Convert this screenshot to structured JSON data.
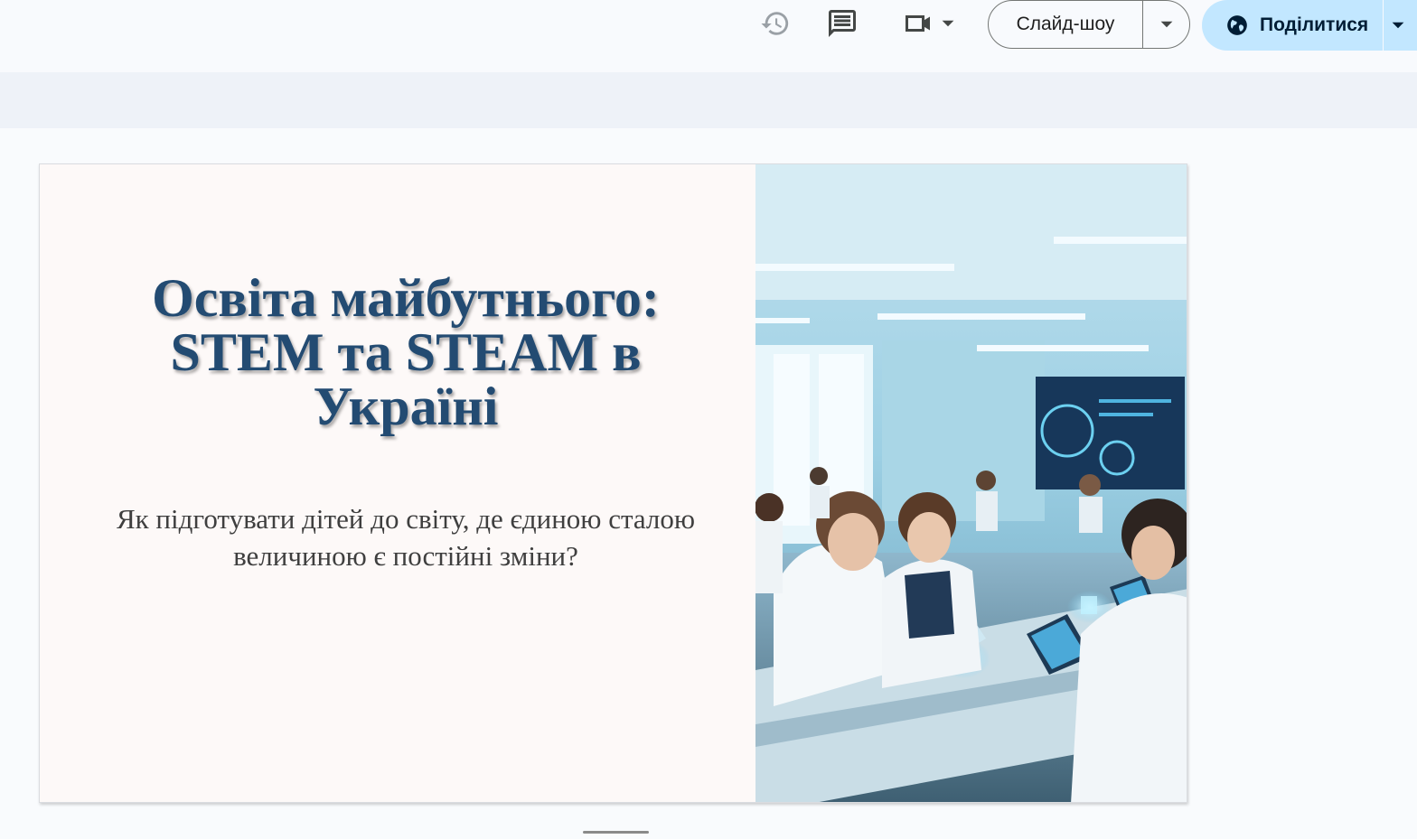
{
  "toolbar": {
    "history_icon": "history-icon",
    "comments_icon": "comment-icon",
    "meet_icon": "video-camera-icon",
    "slideshow_label": "Слайд-шоу",
    "share_label": "Поділитися",
    "share_icon": "globe-icon"
  },
  "colors": {
    "share_bg": "#c2e7ff",
    "title_color": "#234b72",
    "slide_bg": "#fdf9f8"
  },
  "slide": {
    "title": "Освіта майбутнього: STEM та STEAM в Україні",
    "subtitle": "Як підготувати дітей до світу, де єдиною сталою величиною є постійні зміни?",
    "image": "classroom-photo"
  }
}
